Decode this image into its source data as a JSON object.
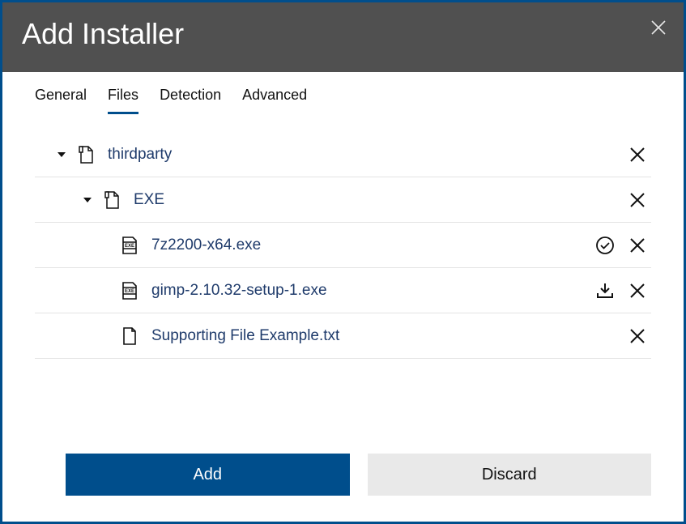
{
  "colors": {
    "accent": "#004e8c",
    "header_bg": "#505050"
  },
  "header": {
    "title": "Add Installer"
  },
  "tabs": {
    "items": [
      {
        "label": "General",
        "active": false
      },
      {
        "label": "Files",
        "active": true
      },
      {
        "label": "Detection",
        "active": false
      },
      {
        "label": "Advanced",
        "active": false
      }
    ]
  },
  "tree": {
    "rows": [
      {
        "level": 0,
        "expandable": true,
        "icon": "folder",
        "label": "thirdparty",
        "actions": [
          "remove"
        ]
      },
      {
        "level": 1,
        "expandable": true,
        "icon": "folder",
        "label": "EXE",
        "actions": [
          "remove"
        ]
      },
      {
        "level": 2,
        "expandable": false,
        "icon": "exe",
        "label": "7z2200-x64.exe",
        "actions": [
          "selected",
          "remove"
        ]
      },
      {
        "level": 2,
        "expandable": false,
        "icon": "exe",
        "label": "gimp-2.10.32-setup-1.exe",
        "actions": [
          "download",
          "remove"
        ]
      },
      {
        "level": 2,
        "expandable": false,
        "icon": "file",
        "label": "Supporting File Example.txt",
        "actions": [
          "remove"
        ]
      }
    ]
  },
  "footer": {
    "primary": "Add",
    "secondary": "Discard"
  }
}
